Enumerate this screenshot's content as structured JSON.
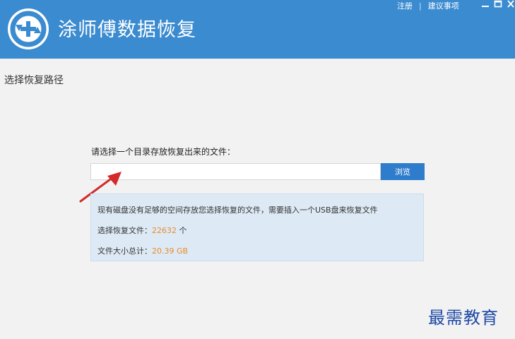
{
  "app": {
    "title": "涂师傅数据恢复",
    "logo_icon": "refresh-plus-icon"
  },
  "toplinks": {
    "register": "注册",
    "separator": "|",
    "suggestion": "建议事项"
  },
  "window_controls": [
    "minimize-icon",
    "maximize-icon",
    "close-icon"
  ],
  "page": {
    "heading": "选择恢复路径"
  },
  "form": {
    "prompt": "请选择一个目录存放恢复出来的文件：",
    "path_value": "",
    "path_placeholder": "",
    "browse_label": "浏览"
  },
  "info": {
    "notice": "现有磁盘没有足够的空间存放您选择恢复的文件，需要插入一个USB盘来恢复文件",
    "files_label": "选择恢复文件：",
    "files_count": "22632",
    "files_unit": "个",
    "size_label": "文件大小总计：",
    "size_value": "20.39 GB"
  },
  "watermark": "最需教育",
  "colors": {
    "header": "#3b8bd0",
    "button": "#2e7ccb",
    "highlight": "#e88a2b",
    "info_bg": "#ddeaf5",
    "arrow": "#d42a2a"
  }
}
